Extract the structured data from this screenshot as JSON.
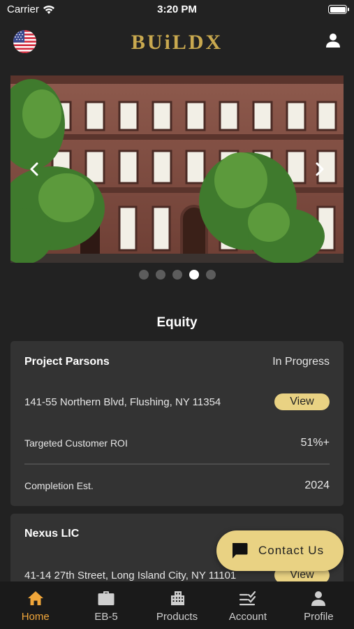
{
  "status_bar": {
    "carrier": "Carrier",
    "time": "3:20 PM"
  },
  "header": {
    "logo": "BUiLDX",
    "flag_icon": "us-flag-icon",
    "user_icon": "user-icon"
  },
  "carousel": {
    "slide_count": 5,
    "active_index": 3
  },
  "section": {
    "title": "Equity"
  },
  "projects": [
    {
      "name": "Project Parsons",
      "status": "In Progress",
      "address": "141-55 Northern Blvd, Flushing, NY 11354",
      "view_label": "View",
      "roi_label": "Targeted Customer ROI",
      "roi_value": "51%+",
      "completion_label": "Completion Est.",
      "completion_value": "2024"
    },
    {
      "name": "Nexus LIC",
      "address": "41-14 27th Street, Long Island City, NY 11101",
      "view_label": "View"
    }
  ],
  "contact": {
    "label": "Contact Us"
  },
  "tabs": [
    {
      "label": "Home",
      "icon": "home-icon",
      "active": true
    },
    {
      "label": "EB-5",
      "icon": "briefcase-icon",
      "active": false
    },
    {
      "label": "Products",
      "icon": "building-icon",
      "active": false
    },
    {
      "label": "Account",
      "icon": "checklist-icon",
      "active": false
    },
    {
      "label": "Profile",
      "icon": "person-icon",
      "active": false
    }
  ],
  "colors": {
    "accent": "#e9d283",
    "active_tab": "#f0a63a",
    "background": "#222222",
    "card": "#333333"
  }
}
